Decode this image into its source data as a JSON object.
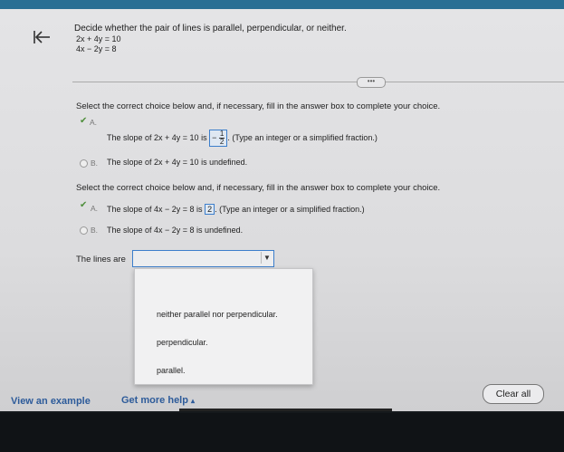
{
  "question": {
    "prompt": "Decide whether the pair of lines is parallel, perpendicular, or neither.",
    "equation1": "2x + 4y = 10",
    "equation2": "4x − 2y = 8"
  },
  "more_label": "•••",
  "part1": {
    "instruction": "Select the correct choice below and, if necessary, fill in the answer box to complete your choice.",
    "choiceA": {
      "letter": "A.",
      "prefix": "The slope of 2x + 4y = 10 is",
      "answer_sign": "−",
      "answer_num": "1",
      "answer_den": "2",
      "suffix": ". (Type an integer or a simplified fraction.)"
    },
    "choiceB": {
      "letter": "B.",
      "text": "The slope of 2x + 4y = 10 is undefined."
    }
  },
  "part2": {
    "instruction": "Select the correct choice below and, if necessary, fill in the answer box to complete your choice.",
    "choiceA": {
      "letter": "A.",
      "prefix": "The slope of 4x − 2y = 8 is",
      "answer": "2",
      "suffix": ". (Type an integer or a simplified fraction.)"
    },
    "choiceB": {
      "letter": "B.",
      "text": "The slope of 4x − 2y = 8 is undefined."
    }
  },
  "lines_label": "The lines are",
  "dropdown_options": [
    "neither parallel nor perpendicular.",
    "perpendicular.",
    "parallel."
  ],
  "footer": {
    "view_example": "View an example",
    "get_help": "Get more help",
    "help_caret": "▴",
    "clear_all": "Clear all"
  },
  "colors": {
    "accent": "#3c7ecb",
    "link": "#2d5b9a",
    "check": "#4f8f3c",
    "topbar": "#2a6f94"
  }
}
